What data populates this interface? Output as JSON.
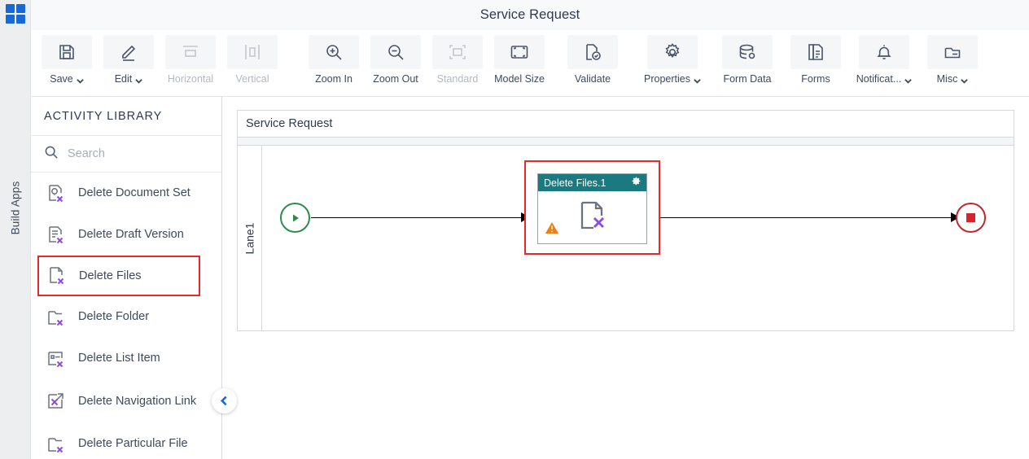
{
  "rail": {
    "logo_icon": "apps-grid-icon",
    "label": "Build Apps"
  },
  "header": {
    "title": "Service Request"
  },
  "toolbar": {
    "items": [
      {
        "label": "Save",
        "icon": "save-icon",
        "caret": true,
        "disabled": false
      },
      {
        "label": "Edit",
        "icon": "pencil-icon",
        "caret": true,
        "disabled": false
      },
      {
        "label": "Horizontal",
        "icon": "horizontal-icon",
        "caret": false,
        "disabled": true
      },
      {
        "label": "Vertical",
        "icon": "vertical-icon",
        "caret": false,
        "disabled": true
      },
      {
        "label": "Zoom In",
        "icon": "zoom-in-icon",
        "caret": false,
        "disabled": false
      },
      {
        "label": "Zoom Out",
        "icon": "zoom-out-icon",
        "caret": false,
        "disabled": false
      },
      {
        "label": "Standard",
        "icon": "standard-size-icon",
        "caret": false,
        "disabled": true
      },
      {
        "label": "Model Size",
        "icon": "model-size-icon",
        "caret": false,
        "disabled": false
      },
      {
        "label": "Validate",
        "icon": "validate-icon",
        "caret": false,
        "disabled": false
      },
      {
        "label": "Properties",
        "icon": "gear-icon",
        "caret": true,
        "disabled": false
      },
      {
        "label": "Form Data",
        "icon": "database-icon",
        "caret": false,
        "disabled": false
      },
      {
        "label": "Forms",
        "icon": "forms-icon",
        "caret": false,
        "disabled": false
      },
      {
        "label": "Notificat...",
        "icon": "bell-icon",
        "caret": true,
        "disabled": false
      },
      {
        "label": "Misc",
        "icon": "misc-folder-icon",
        "caret": true,
        "disabled": false
      }
    ]
  },
  "sidebar": {
    "title": "ACTIVITY LIBRARY",
    "search": {
      "value": "",
      "placeholder": "Search",
      "icon": "search-icon"
    },
    "collapse_icon": "chevron-left-icon",
    "items": [
      {
        "label": "Delete Document Set",
        "icon": "delete-document-set-icon",
        "selected": false
      },
      {
        "label": "Delete Draft Version",
        "icon": "delete-draft-version-icon",
        "selected": false
      },
      {
        "label": "Delete Files",
        "icon": "delete-files-icon",
        "selected": true
      },
      {
        "label": "Delete Folder",
        "icon": "delete-folder-icon",
        "selected": false
      },
      {
        "label": "Delete List Item",
        "icon": "delete-list-item-icon",
        "selected": false
      },
      {
        "label": "Delete Navigation Link",
        "icon": "delete-navigation-link-icon",
        "selected": false
      },
      {
        "label": "Delete Particular File",
        "icon": "delete-particular-file-icon",
        "selected": false
      }
    ]
  },
  "canvas": {
    "pool_title": "Service Request",
    "lane_label": "Lane1",
    "start_event": {
      "icon": "start-event-icon",
      "color": "#2f8a4e"
    },
    "end_event": {
      "icon": "end-event-icon",
      "color": "#c0262b"
    },
    "node": {
      "title": "Delete Files.1",
      "header_color": "#1a7a80",
      "settings_icon": "gear-icon",
      "warning_icon": "warning-triangle-icon",
      "body_icon": "delete-files-icon",
      "selected": true,
      "selection_color": "#e8292b"
    }
  }
}
